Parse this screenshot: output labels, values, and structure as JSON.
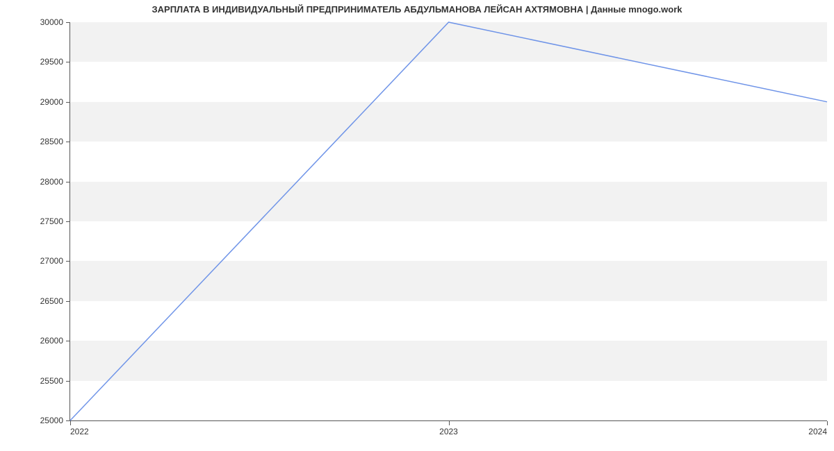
{
  "chart_data": {
    "type": "line",
    "title": "ЗАРПЛАТА В ИНДИВИДУАЛЬНЫЙ ПРЕДПРИНИМАТЕЛЬ АБДУЛЬМАНОВА ЛЕЙСАН АХТЯМОВНА | Данные mnogo.work",
    "x": [
      2022,
      2023,
      2024
    ],
    "values": [
      25000,
      30000,
      29000
    ],
    "xlabel": "",
    "ylabel": "",
    "ylim": [
      25000,
      30000
    ],
    "yticks": [
      25000,
      25500,
      26000,
      26500,
      27000,
      27500,
      28000,
      28500,
      29000,
      29500,
      30000
    ],
    "xticks": [
      2022,
      2023,
      2024
    ],
    "line_color": "#6f94e8",
    "band_color": "#f2f2f2"
  }
}
